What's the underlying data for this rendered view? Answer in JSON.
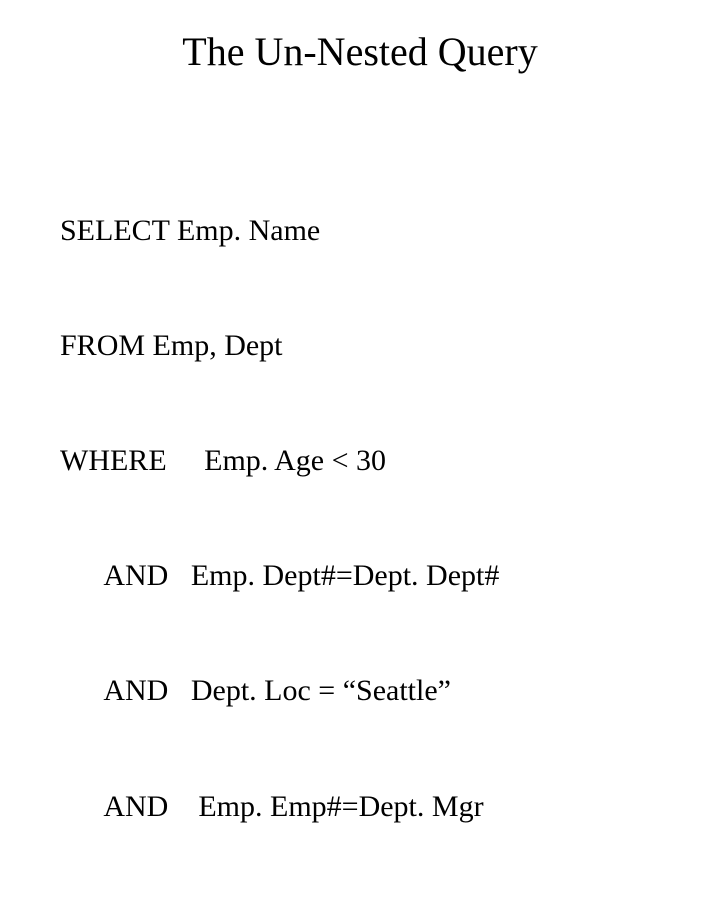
{
  "title": "The Un-Nested Query",
  "query": {
    "line1": "SELECT Emp. Name",
    "line2": "FROM Emp, Dept",
    "line3": "WHERE     Emp. Age < 30",
    "line4": "      AND   Emp. Dept#=Dept. Dept#",
    "line5": "      AND   Dept. Loc = “Seattle”",
    "line6": "      AND    Emp. Emp#=Dept. Mgr"
  }
}
